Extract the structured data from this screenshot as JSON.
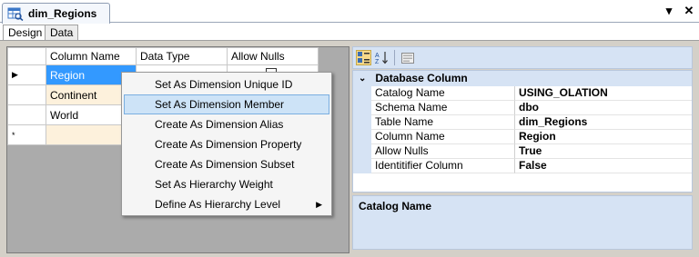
{
  "document_tab": {
    "title": "dim_Regions",
    "icon": "table-design-icon"
  },
  "window_controls": {
    "dropdown": "▾",
    "close": "✕"
  },
  "inner_tabs": [
    {
      "label": "Design",
      "active": true
    },
    {
      "label": "Data",
      "active": false
    }
  ],
  "grid": {
    "headers": {
      "column_name": "Column Name",
      "data_type": "Data Type",
      "allow_nulls": "Allow Nulls"
    },
    "rows": [
      {
        "marker": "▶",
        "name": "Region"
      },
      {
        "marker": "",
        "name": "Continent"
      },
      {
        "marker": "",
        "name": "World"
      },
      {
        "marker": "*",
        "name": ""
      }
    ]
  },
  "context_menu": {
    "items": [
      {
        "label": "Set As Dimension Unique ID"
      },
      {
        "label": "Set As Dimension Member",
        "highlighted": true
      },
      {
        "label": "Create As Dimension Alias"
      },
      {
        "label": "Create As Dimension Property"
      },
      {
        "label": "Create As Dimension Subset"
      },
      {
        "label": "Set As Hierarchy Weight"
      },
      {
        "label": "Define As Hierarchy Level",
        "submenu": true
      }
    ],
    "submenu_arrow": "▶"
  },
  "properties": {
    "toolbar": {
      "categorized": "categorized-icon",
      "alphabetical": "sort-az-icon",
      "pages": "property-pages-icon"
    },
    "category": {
      "caret": "⌄",
      "title": "Database Column"
    },
    "rows": [
      {
        "name": "Catalog Name",
        "value": "USING_OLATION"
      },
      {
        "name": "Schema Name",
        "value": "dbo"
      },
      {
        "name": "Table Name",
        "value": "dim_Regions"
      },
      {
        "name": "Column Name",
        "value": "Region"
      },
      {
        "name": "Allow Nulls",
        "value": "True"
      },
      {
        "name": "Identitifier Column",
        "value": "False"
      }
    ],
    "description_title": "Catalog Name"
  },
  "colors": {
    "selection": "#3399ff",
    "panel_blue": "#d6e3f4",
    "menu_highlight": "#cde3f7",
    "new_row": "#fdf1dc"
  }
}
